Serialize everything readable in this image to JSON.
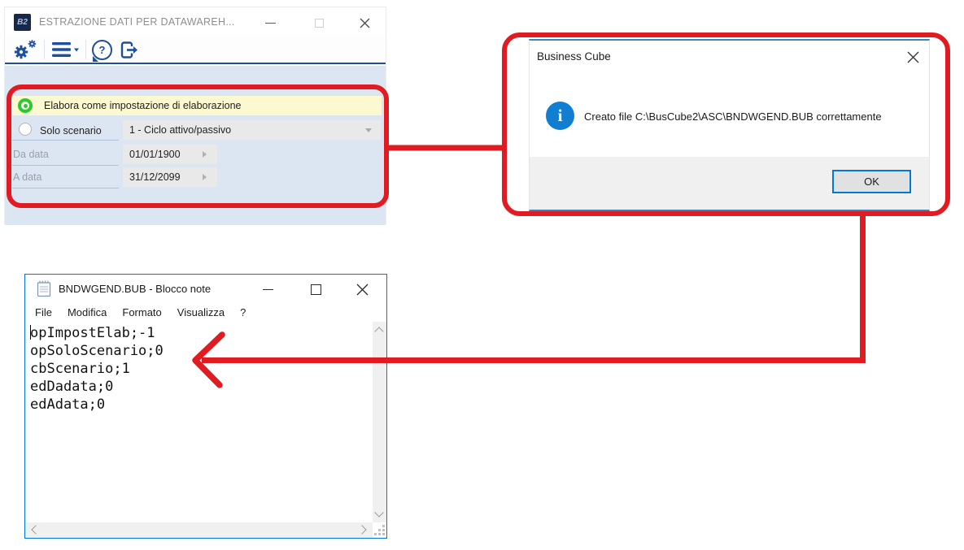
{
  "colors": {
    "annotation_red": "#e11b22",
    "toolbar_navy": "#1d4f9c",
    "accent_blue": "#0078d7"
  },
  "main_window": {
    "logo_text": "B2",
    "title": "ESTRAZIONE DATI PER DATAWAREH...",
    "toolbar": {
      "help_glyph": "?"
    },
    "form": {
      "elabora_label": "Elabora come impostazione di elaborazione",
      "solo_scenario_label": "Solo scenario",
      "scenario_value": "1 - Ciclo attivo/passivo",
      "da_data_label": "Da data",
      "da_data_value": "01/01/1900",
      "a_data_label": "A data",
      "a_data_value": "31/12/2099"
    }
  },
  "dialog": {
    "title": "Business Cube",
    "info_glyph": "i",
    "message": "Creato file C:\\BusCube2\\ASC\\BNDWGEND.BUB correttamente",
    "ok_label": "OK"
  },
  "notepad": {
    "title": "BNDWGEND.BUB - Blocco note",
    "menu": [
      "File",
      "Modifica",
      "Formato",
      "Visualizza",
      "?"
    ],
    "lines": [
      "opImpostElab;-1",
      "opSoloScenario;0",
      "cbScenario;1",
      "edDadata;0",
      "edAdata;0"
    ]
  }
}
